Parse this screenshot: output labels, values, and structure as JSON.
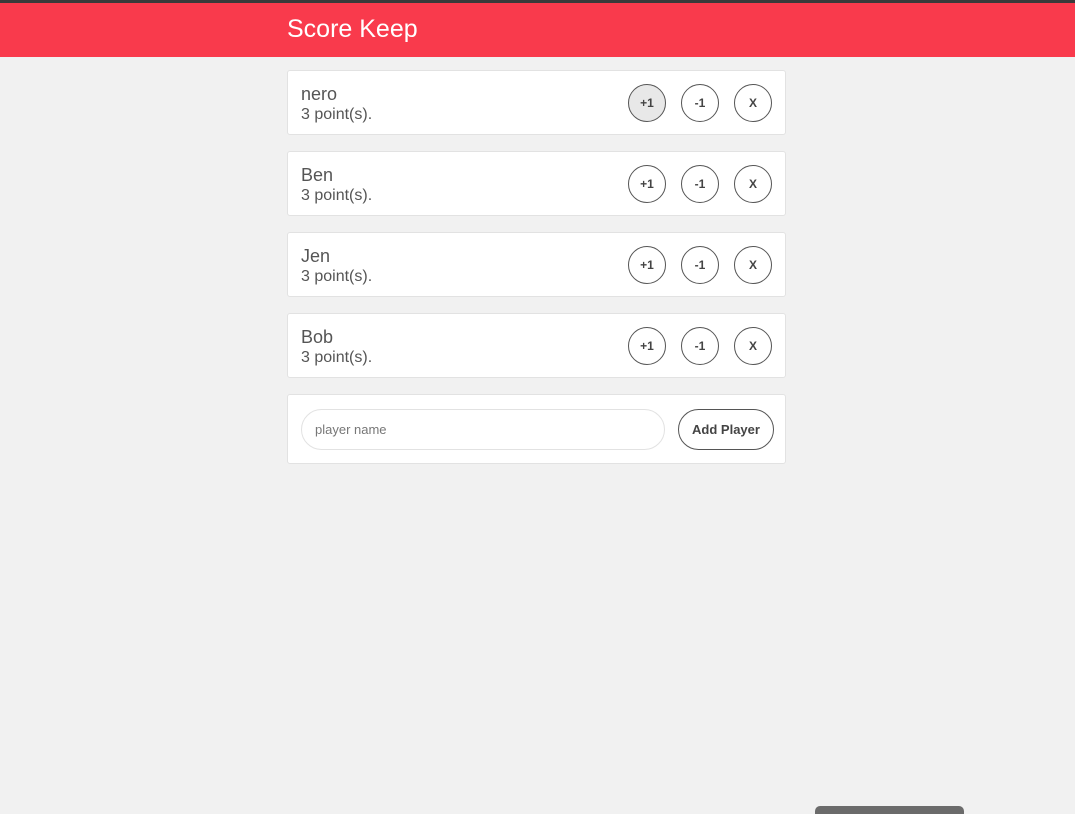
{
  "app": {
    "title": "Score Keep",
    "accent_color": "#f93a4c"
  },
  "players": [
    {
      "name": "nero",
      "score_text": "3 point(s).",
      "plus_label": "+1",
      "minus_label": "-1",
      "remove_label": "X"
    },
    {
      "name": "Ben",
      "score_text": "3 point(s).",
      "plus_label": "+1",
      "minus_label": "-1",
      "remove_label": "X"
    },
    {
      "name": "Jen",
      "score_text": "3 point(s).",
      "plus_label": "+1",
      "minus_label": "-1",
      "remove_label": "X"
    },
    {
      "name": "Bob",
      "score_text": "3 point(s).",
      "plus_label": "+1",
      "minus_label": "-1",
      "remove_label": "X"
    }
  ],
  "add_player": {
    "placeholder": "player name",
    "value": "",
    "button_label": "Add Player"
  }
}
